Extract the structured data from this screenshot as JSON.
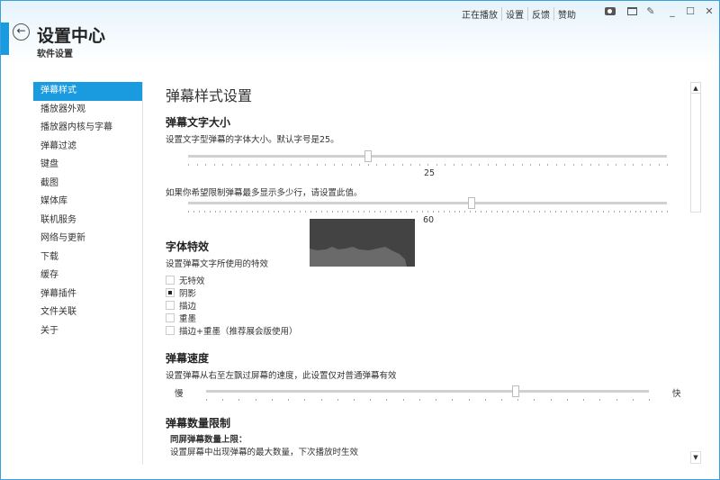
{
  "header": {
    "title": "设置中心",
    "subtitle": "软件设置",
    "links": [
      "正在播放",
      "设置",
      "反馈",
      "赞助"
    ],
    "window_icons": [
      "camera-icon",
      "mini-mode-icon",
      "pin-icon",
      "minimize-icon",
      "maximize-icon",
      "close-icon"
    ]
  },
  "sidebar": {
    "items": [
      "弹幕样式",
      "播放器外观",
      "播放器内核与字幕",
      "弹幕过滤",
      "键盘",
      "截图",
      "媒体库",
      "联机服务",
      "网络与更新",
      "下载",
      "缓存",
      "弹幕插件",
      "文件关联",
      "关于"
    ],
    "active_index": 0
  },
  "main": {
    "title": "弹幕样式设置",
    "font_size": {
      "heading": "弹幕文字大小",
      "desc": "设置文字型弹幕的字体大小。默认字号是25。",
      "value_label": "25",
      "slider_fraction": 0.376,
      "lines_desc": "如果你希望限制弹幕最多显示多少行，请设置此值。",
      "lines_label": "60",
      "lines_fraction": 0.593
    },
    "effects": {
      "heading": "字体特效",
      "desc": "设置弹幕文字所使用的特效",
      "options": [
        {
          "label": "无特效",
          "checked": false
        },
        {
          "label": "阴影",
          "checked": true
        },
        {
          "label": "描边",
          "checked": false
        },
        {
          "label": "重墨",
          "checked": false
        },
        {
          "label": "描边+重墨（推荐展会版使用）",
          "checked": false
        }
      ]
    },
    "speed": {
      "heading": "弹幕速度",
      "desc": "设置弹幕从右至左飘过屏幕的速度，此设置仅对普通弹幕有效",
      "slow": "慢",
      "fast": "快",
      "slider_fraction": 0.7
    },
    "limit": {
      "heading": "弹幕数量限制",
      "sub": "同屏弹幕数量上限：",
      "desc": "设置屏幕中出现弹幕的最大数量，下次播放时生效"
    }
  },
  "scrollbar": {
    "up": "▲",
    "down": "▼"
  },
  "colors": {
    "accent": "#1a9be0",
    "border": "#3aa0e0"
  }
}
